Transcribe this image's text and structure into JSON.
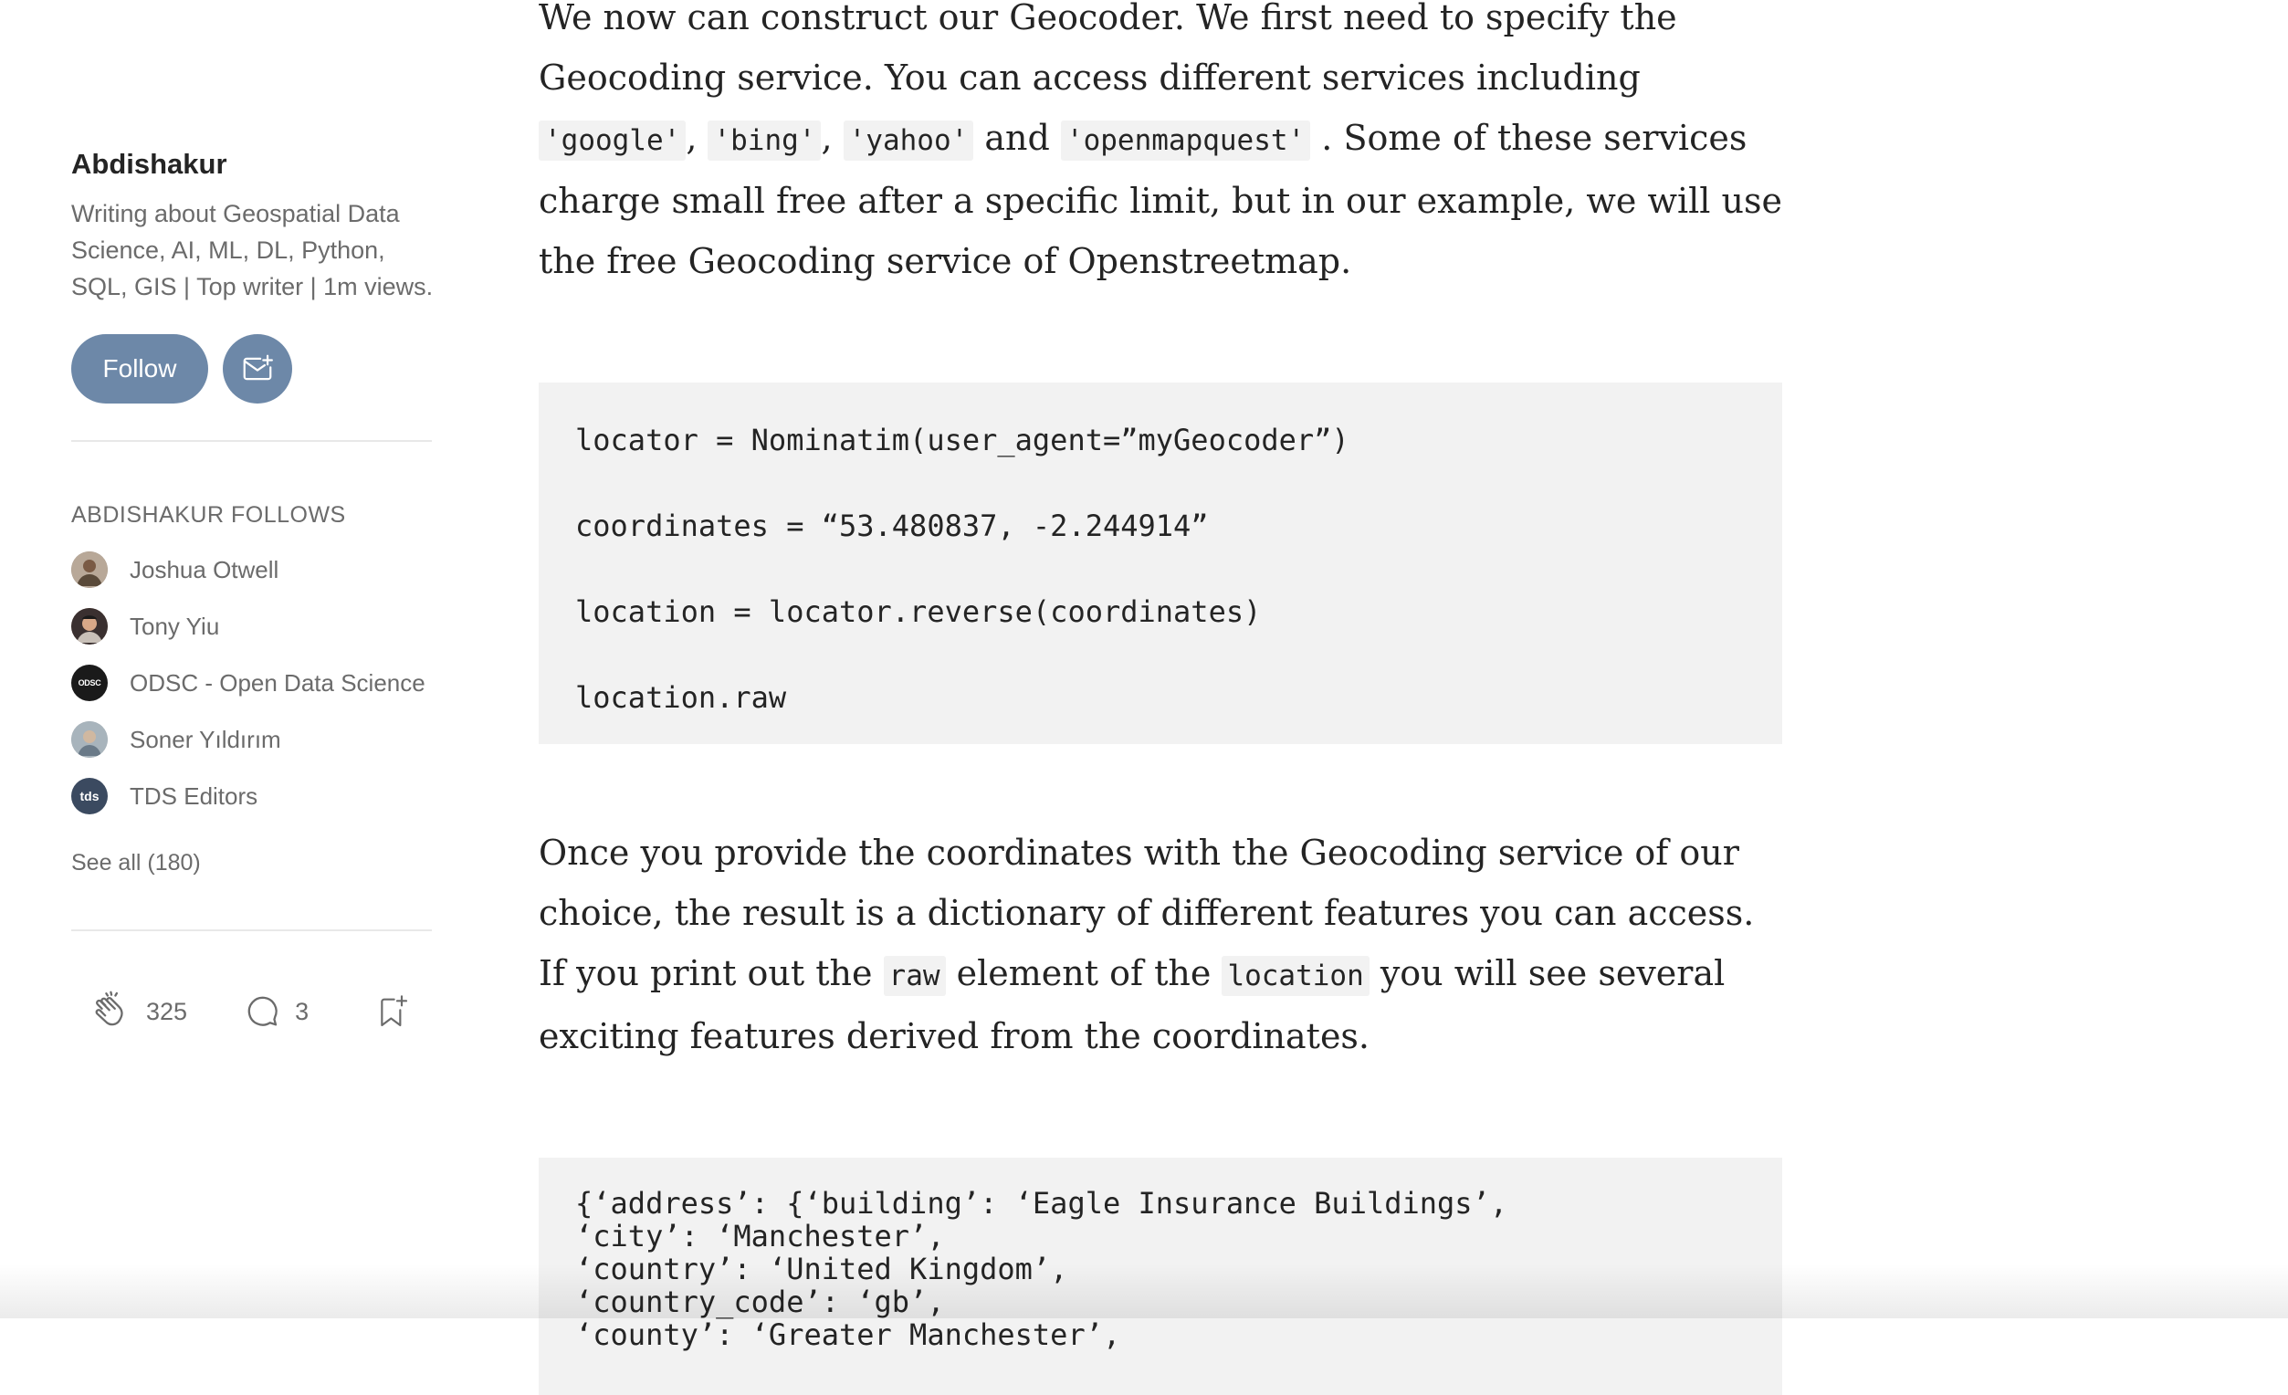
{
  "sidebar": {
    "author_name": "Abdishakur",
    "author_bio": "Writing about Geospatial Data Science, AI, ML, DL, Python, SQL, GIS | Top writer | 1m views.",
    "follow_label": "Follow",
    "subscribe_icon": "mail-plus-icon",
    "follows_heading": "ABDISHAKUR FOLLOWS",
    "follows": [
      {
        "name": "Joshua Otwell",
        "avatar_color": "#8a7a6a"
      },
      {
        "name": "Tony Yiu",
        "avatar_color": "#6a5040"
      },
      {
        "name": "ODSC - Open Data Science",
        "avatar_color": "#1a1a1a",
        "avatar_text": "ODSC"
      },
      {
        "name": "Soner Yıldırım",
        "avatar_color": "#9aa2a8"
      },
      {
        "name": "TDS Editors",
        "avatar_color": "#3b4a60",
        "avatar_text": "tds"
      }
    ],
    "see_all": "See all (180)",
    "claps": "325",
    "comments": "3"
  },
  "article": {
    "p1_a": "We now can construct our Geocoder. We first need to specify the Geocoding service. You can access different services including ",
    "p1_code1": "'google'",
    "p1_b": ", ",
    "p1_code2": "'bing'",
    "p1_c": ", ",
    "p1_code3": "'yahoo'",
    "p1_d": " and ",
    "p1_code4": "'openmapquest'",
    "p1_e": " . Some of these services charge small free after a specific limit, but in our example, we will use the free Geocoding service of Openstreetmap.",
    "code1": [
      "locator = Nominatim(user_agent=”myGeocoder”)",
      "coordinates = “53.480837, -2.244914”",
      "location = locator.reverse(coordinates)",
      "location.raw"
    ],
    "p2_a": "Once you provide the coordinates with the Geocoding service of our choice, the result is a dictionary of different features you can access. If you print out the ",
    "p2_code1": "raw",
    "p2_b": " element of the ",
    "p2_code2": "location",
    "p2_c": " you will see several exciting features derived from the coordinates.",
    "code2": [
      "{‘address’: {‘building’: ‘Eagle Insurance Buildings’,",
      "‘city’: ‘Manchester’,",
      "‘country’: ‘United Kingdom’,",
      "‘country_code’: ‘gb’,",
      "‘county’: ‘Greater Manchester’,"
    ]
  },
  "colors": {
    "follow_button": "#6d88a8",
    "code_background": "#f2f2f2",
    "muted_text": "#6b6b6b"
  }
}
